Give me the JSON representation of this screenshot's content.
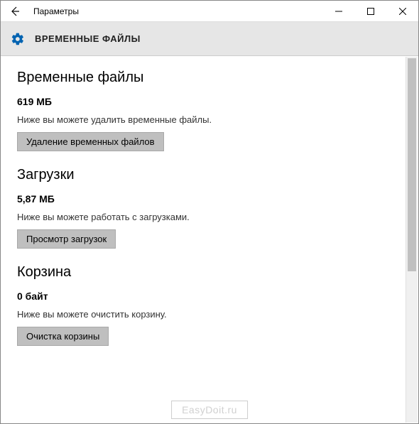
{
  "titlebar": {
    "title": "Параметры"
  },
  "header": {
    "title": "ВРЕМЕННЫЕ ФАЙЛЫ"
  },
  "sections": {
    "temp": {
      "title": "Временные файлы",
      "size": "619 МБ",
      "desc": "Ниже вы можете удалить временные файлы.",
      "button": "Удаление временных файлов"
    },
    "downloads": {
      "title": "Загрузки",
      "size": "5,87 МБ",
      "desc": "Ниже вы можете работать с загрузками.",
      "button": "Просмотр загрузок"
    },
    "recycle": {
      "title": "Корзина",
      "size": "0 байт",
      "desc": "Ниже вы можете очистить корзину.",
      "button": "Очистка корзины"
    }
  },
  "watermark": "EasyDoit.ru"
}
